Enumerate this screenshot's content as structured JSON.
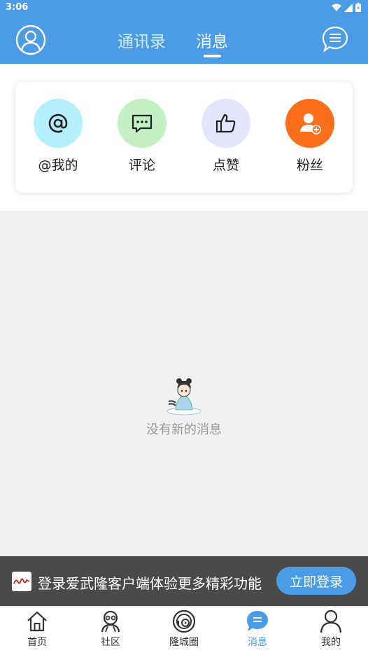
{
  "status_bar": {
    "time": "3:06"
  },
  "header": {
    "tabs": [
      {
        "label": "通讯录",
        "active": false
      },
      {
        "label": "消息",
        "active": true
      }
    ]
  },
  "categories": [
    {
      "label": "@我的",
      "icon": "at-icon",
      "color": "#b3f0fb"
    },
    {
      "label": "评论",
      "icon": "comment-icon",
      "color": "#c4efc4"
    },
    {
      "label": "点赞",
      "icon": "thumbs-up-icon",
      "color": "#e3e6fb"
    },
    {
      "label": "粉丝",
      "icon": "add-fan-icon",
      "color": "#fb6f1c"
    }
  ],
  "empty_state": {
    "text": "没有新的消息"
  },
  "login_bar": {
    "promo": "登录爱武隆客户端体验更多精彩功能",
    "button": "立即登录"
  },
  "tabbar": {
    "items": [
      {
        "label": "首页",
        "icon": "home-icon",
        "active": false
      },
      {
        "label": "社区",
        "icon": "community-icon",
        "active": false
      },
      {
        "label": "隆城圈",
        "icon": "circle-icon",
        "active": false
      },
      {
        "label": "消息",
        "icon": "message-icon",
        "active": true
      },
      {
        "label": "我的",
        "icon": "person-icon",
        "active": false
      }
    ]
  },
  "colors": {
    "accent": "#4a9ce6",
    "background": "#f0f0f0",
    "login_bar": "#4a4a4a"
  }
}
